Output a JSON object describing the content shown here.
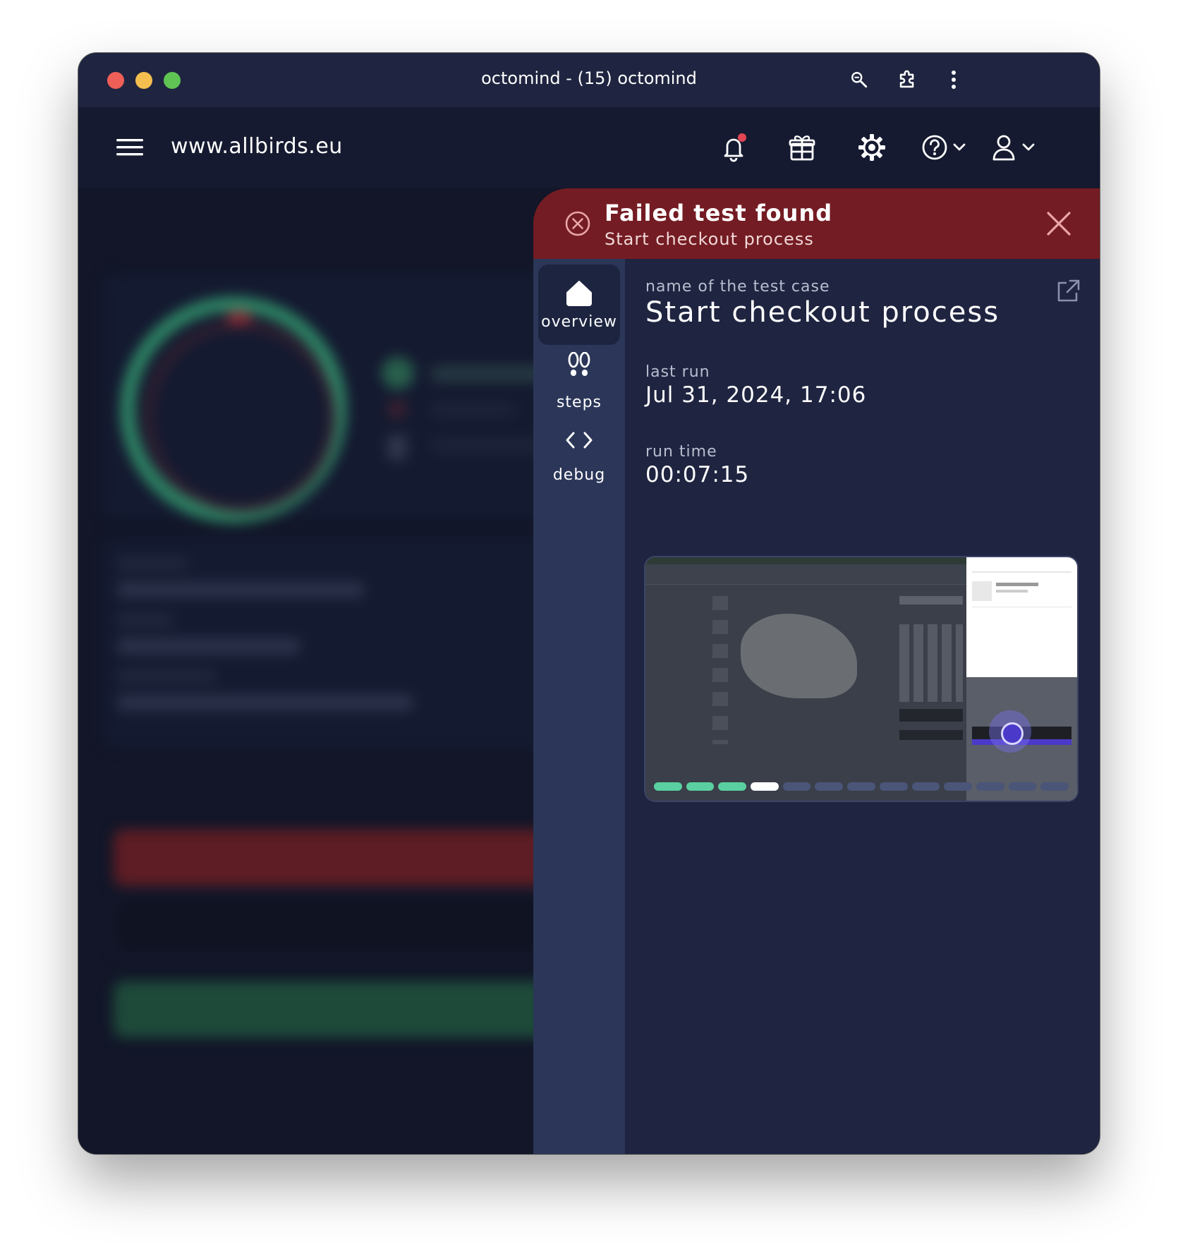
{
  "window": {
    "title": "octomind - (15) octomind"
  },
  "appbar": {
    "site": "www.allbirds.eu",
    "icons": [
      "menu-icon",
      "bell-icon",
      "gift-icon",
      "gear-icon",
      "help-icon",
      "user-icon"
    ]
  },
  "panel": {
    "header_title": "Failed test found",
    "header_subtitle": "Start checkout process",
    "nav": [
      {
        "label": "overview",
        "icon": "home-icon",
        "active": true
      },
      {
        "label": "steps",
        "icon": "footsteps-icon",
        "active": false
      },
      {
        "label": "debug",
        "icon": "code-icon",
        "active": false
      }
    ],
    "fields": {
      "name_label": "name of the test case",
      "name_value": "Start checkout process",
      "last_run_label": "last run",
      "last_run_value": "Jul 31, 2024, 17:06",
      "run_time_label": "run time",
      "run_time_value": "00:07:15"
    },
    "steps_progress": {
      "total": 13,
      "passed": 3,
      "current": 4
    }
  },
  "colors": {
    "danger": "#741c23",
    "passed": "#5ad0a0",
    "pending": "#4a5578",
    "current": "#ffffff"
  }
}
